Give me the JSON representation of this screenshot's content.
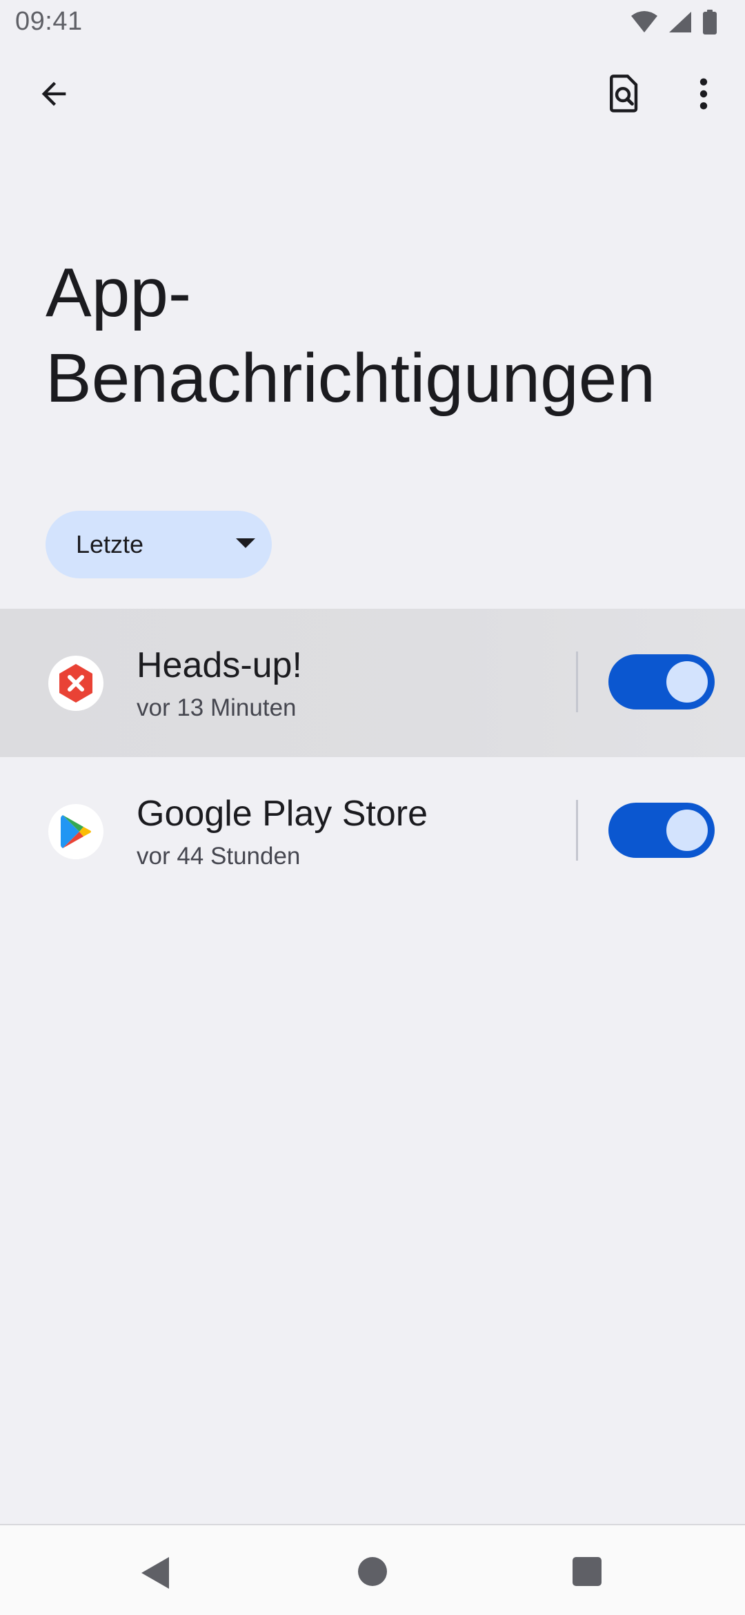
{
  "status_bar": {
    "time": "09:41",
    "icons": [
      "wifi-icon",
      "cellular-signal-icon",
      "battery-icon"
    ]
  },
  "app_bar": {
    "back_icon": "arrow-back-icon",
    "search_icon": "search-settings-icon",
    "more_icon": "more-vert-icon"
  },
  "page": {
    "title": "App-Benachrichtigungen"
  },
  "filter": {
    "selected": "Letzte",
    "icon": "dropdown-caret-icon"
  },
  "apps": [
    {
      "name": "Heads-up!",
      "time": "vor 13 Minuten",
      "icon": "heads-up-app-icon",
      "enabled": true,
      "highlighted": true
    },
    {
      "name": "Google Play Store",
      "time": "vor 44 Stunden",
      "icon": "google-play-icon",
      "enabled": true,
      "highlighted": false
    }
  ],
  "nav_bar": {
    "items": [
      "nav-back-icon",
      "nav-home-icon",
      "nav-recents-icon"
    ]
  },
  "colors": {
    "background": "#f0f0f4",
    "accent": "#0b57d0",
    "chip": "#d3e3fd",
    "toggle_thumb": "#d3e3fd"
  }
}
